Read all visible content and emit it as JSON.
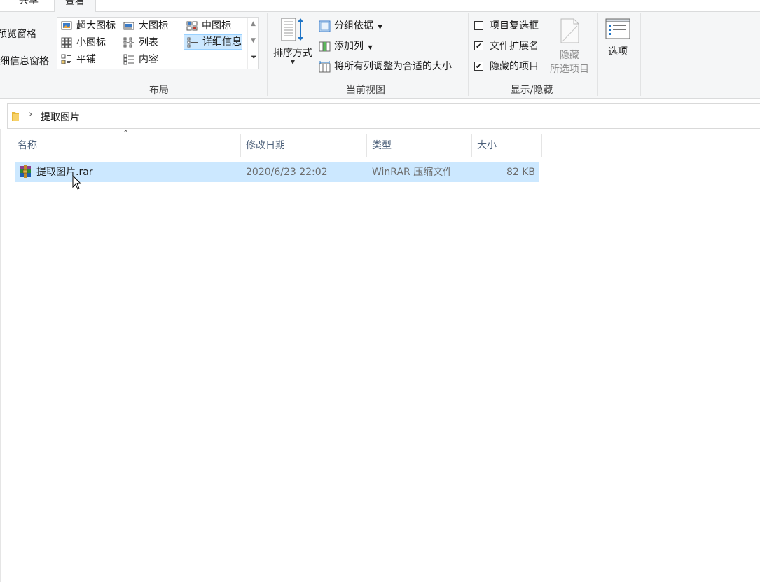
{
  "tabs": {
    "share": "共享",
    "view": "查看"
  },
  "panes": {
    "preview_pane": "预览窗格",
    "details_pane": "详细信息窗格"
  },
  "layout": {
    "group_label": "布局",
    "items": [
      {
        "label": "超大图标",
        "icon": "extra-large-icons-icon"
      },
      {
        "label": "大图标",
        "icon": "large-icons-icon"
      },
      {
        "label": "中图标",
        "icon": "medium-icons-icon"
      },
      {
        "label": "小图标",
        "icon": "small-icons-icon"
      },
      {
        "label": "列表",
        "icon": "list-icon"
      },
      {
        "label": "详细信息",
        "icon": "details-icon",
        "selected": true
      },
      {
        "label": "平铺",
        "icon": "tiles-icon"
      },
      {
        "label": "内容",
        "icon": "content-icon"
      }
    ]
  },
  "current_view": {
    "group_label": "当前视图",
    "sort_by": "排序方式",
    "group_by": "分组依据",
    "add_columns": "添加列",
    "size_all_columns": "将所有列调整为合适的大小"
  },
  "show_hide": {
    "group_label": "显示/隐藏",
    "item_checkboxes": {
      "label": "项目复选框",
      "checked": false
    },
    "file_extensions": {
      "label": "文件扩展名",
      "checked": true
    },
    "hidden_items": {
      "label": "隐藏的项目",
      "checked": true
    },
    "hide_selected_line1": "隐藏",
    "hide_selected_line2": "所选项目"
  },
  "options": {
    "label": "选项"
  },
  "address": {
    "crumb": "提取图片"
  },
  "columns": {
    "name": "名称",
    "date": "修改日期",
    "type": "类型",
    "size": "大小"
  },
  "files": [
    {
      "name": "提取图片.rar",
      "date": "2020/6/23 22:02",
      "type": "WinRAR 压缩文件",
      "size": "82 KB",
      "selected": true
    }
  ],
  "colors": {
    "selection": "#cce8ff",
    "ribbon_bg": "#f5f6f7",
    "accent": "#0078d7"
  }
}
